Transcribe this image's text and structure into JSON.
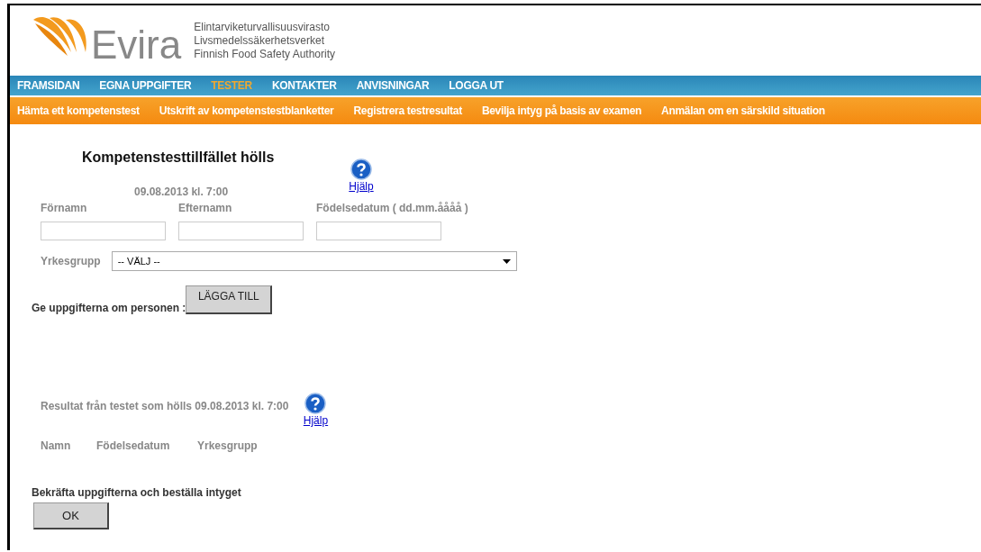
{
  "header": {
    "logo_text": "Evira",
    "agency_names": [
      "Elintarviketurvallisuusvirasto",
      "Livsmedelssäkerhetsverket",
      "Finnish Food Safety Authority"
    ]
  },
  "main_nav": [
    {
      "label": "FRAMSIDAN",
      "selected": false
    },
    {
      "label": "EGNA UPPGIFTER",
      "selected": false
    },
    {
      "label": "TESTER",
      "selected": true
    },
    {
      "label": "KONTAKTER",
      "selected": false
    },
    {
      "label": "ANVISNINGAR",
      "selected": false
    },
    {
      "label": "LOGGA UT",
      "selected": false
    }
  ],
  "sub_nav": [
    "Hämta ett kompetenstest",
    "Utskrift av kompetenstestblanketter",
    "Registrera testresultat",
    "Bevilja intyg på basis av examen",
    "Anmälan om en särskild situation"
  ],
  "form": {
    "title": "Kompetenstesttillfället hölls",
    "date": "09.08.2013 kl. 7:00",
    "help": "Hjälp",
    "fields": [
      {
        "label": "Förnamn"
      },
      {
        "label": "Efternamn"
      },
      {
        "label": "Födelsedatum ( dd.mm.åååå )"
      }
    ],
    "group_label": "Yrkesgrupp",
    "group_value": "-- VÄLJ --",
    "add_prompt": "Ge uppgifterna om personen :",
    "add_button": "LÄGGA TILL"
  },
  "results": {
    "title": "Resultat från testet som hölls 09.08.2013 kl. 7:00",
    "help": "Hjälp",
    "columns": [
      "Namn",
      "Födelsedatum",
      "Yrkesgrupp"
    ]
  },
  "confirm": {
    "prompt": "Bekräfta uppgifterna och beställa intyget",
    "button": "OK"
  }
}
